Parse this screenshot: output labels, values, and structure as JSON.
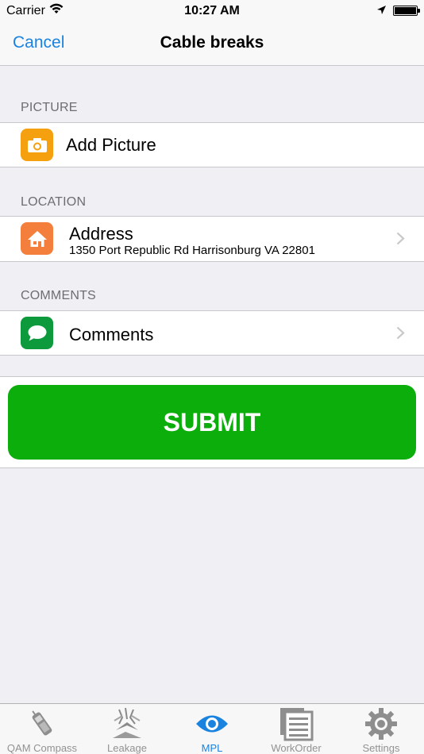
{
  "status_bar": {
    "carrier": "Carrier",
    "time": "10:27 AM"
  },
  "nav": {
    "cancel": "Cancel",
    "title": "Cable breaks"
  },
  "sections": {
    "picture": {
      "header": "PICTURE",
      "label": "Add Picture",
      "icon": "camera-icon",
      "color": "#f5a00f"
    },
    "location": {
      "header": "LOCATION",
      "label": "Address",
      "sub": "1350 Port Republic Rd Harrisonburg VA 22801",
      "icon": "house-icon",
      "color": "#f47f3c"
    },
    "comments": {
      "header": "COMMENTS",
      "label": "Comments",
      "icon": "speech-bubble-icon",
      "color": "#0c9a3c"
    }
  },
  "submit": {
    "label": "SUBMIT",
    "color": "#0cae0c"
  },
  "tabs": [
    {
      "label": "QAM Compass",
      "icon": "phone-icon",
      "active": false
    },
    {
      "label": "Leakage",
      "icon": "leakage-icon",
      "active": false
    },
    {
      "label": "MPL",
      "icon": "eye-icon",
      "active": true
    },
    {
      "label": "WorkOrder",
      "icon": "workorder-icon",
      "active": false
    },
    {
      "label": "Settings",
      "icon": "gear-icon",
      "active": false
    }
  ],
  "accent": "#1a83e0"
}
